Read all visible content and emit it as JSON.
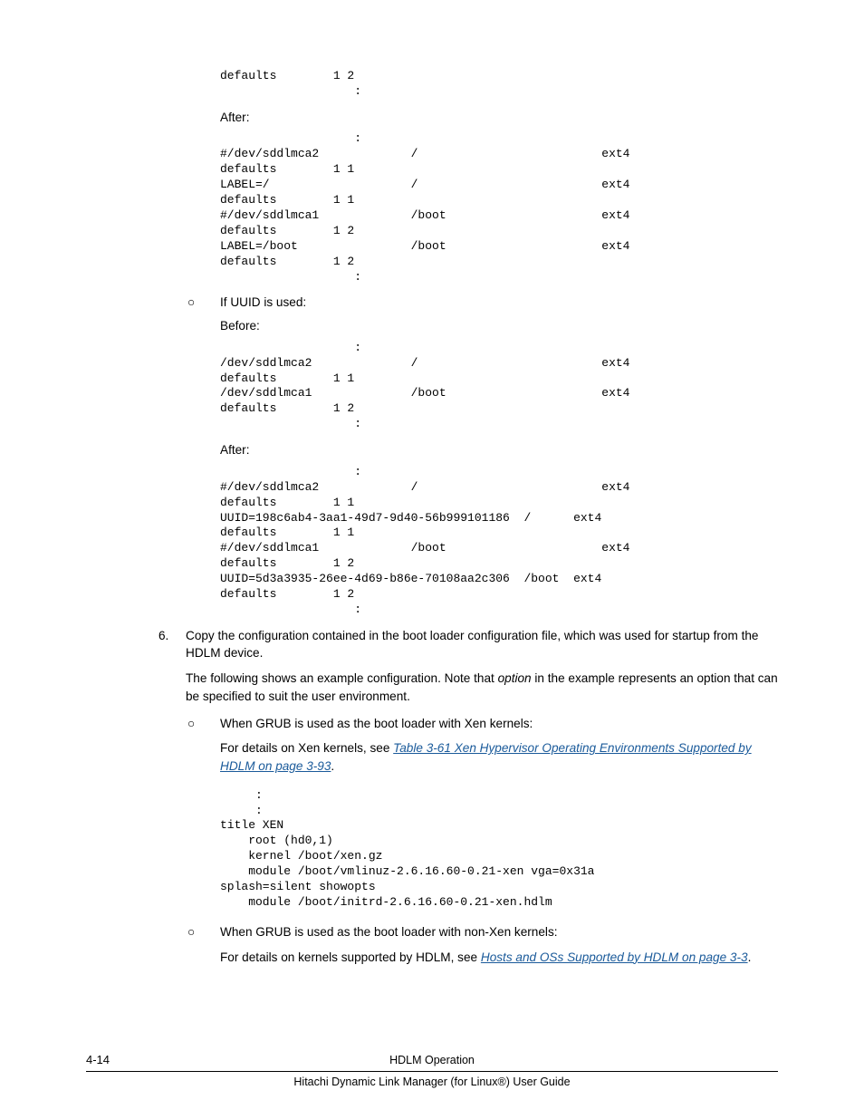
{
  "code1": "defaults        1 2\n                   :",
  "after1_label": "After:",
  "code2": "                   :\n#/dev/sddlmca2             /                          ext4\ndefaults        1 1\nLABEL=/                    /                          ext4\ndefaults        1 1\n#/dev/sddlmca1             /boot                      ext4\ndefaults        1 2\nLABEL=/boot                /boot                      ext4\ndefaults        1 2\n                   :",
  "uuid_heading": "If UUID is used:",
  "before_label": "Before:",
  "code3": "                   :\n/dev/sddlmca2              /                          ext4\ndefaults        1 1\n/dev/sddlmca1              /boot                      ext4\ndefaults        1 2\n                   :",
  "after2_label": "After:",
  "code4": "                   :\n#/dev/sddlmca2             /                          ext4\ndefaults        1 1\nUUID=198c6ab4-3aa1-49d7-9d40-56b999101186  /      ext4\ndefaults        1 1\n#/dev/sddlmca1             /boot                      ext4\ndefaults        1 2\nUUID=5d3a3935-26ee-4d69-b86e-70108aa2c306  /boot  ext4\ndefaults        1 2\n                   :",
  "step6_num": "6.",
  "step6_a": "Copy the configuration contained in the boot loader configuration file, which was used for startup from the HDLM device.",
  "step6_b_pre": "The following shows an example configuration. Note that ",
  "step6_b_em": "option",
  "step6_b_post": " in the example represents an option that can be specified to suit the user environment.",
  "grub_xen": "When GRUB is used as the boot loader with Xen kernels:",
  "xen_details_pre": "For details on Xen kernels, see ",
  "xen_link": "Table 3-61 Xen Hypervisor Operating Environments Supported by HDLM on page 3-93",
  "xen_details_post": ".",
  "code5": "     :\n     :\ntitle XEN\n    root (hd0,1)\n    kernel /boot/xen.gz\n    module /boot/vmlinuz-2.6.16.60-0.21-xen vga=0x31a\nsplash=silent showopts\n    module /boot/initrd-2.6.16.60-0.21-xen.hdlm",
  "grub_nonxen": "When GRUB is used as the boot loader with non-Xen kernels:",
  "nonxen_details_pre": "For details on kernels supported by HDLM, see ",
  "nonxen_link": "Hosts and OSs Supported by HDLM on page 3-3",
  "nonxen_details_post": ".",
  "page_num": "4-14",
  "footer_title": "HDLM Operation",
  "footer_guide": "Hitachi Dynamic Link Manager (for Linux®) User Guide",
  "circ": "○"
}
